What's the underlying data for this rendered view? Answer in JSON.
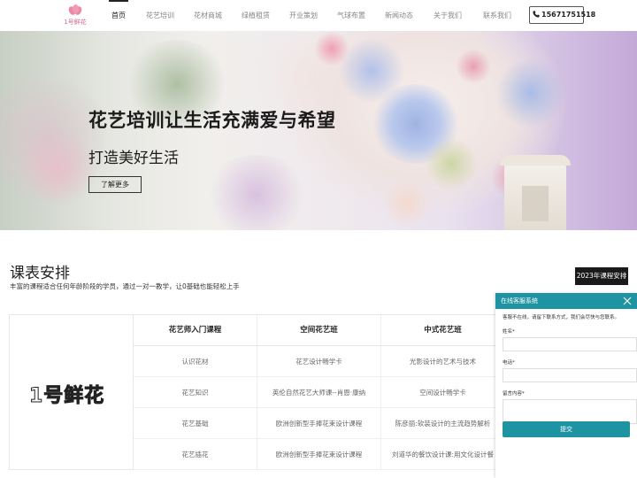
{
  "header": {
    "logo_text": "1号鲜花",
    "nav": [
      {
        "label": "首页",
        "active": true
      },
      {
        "label": "花艺培训",
        "active": false
      },
      {
        "label": "花材商城",
        "active": false
      },
      {
        "label": "绿植租赁",
        "active": false
      },
      {
        "label": "开业策划",
        "active": false
      },
      {
        "label": "气球布置",
        "active": false
      },
      {
        "label": "新闻动态",
        "active": false
      },
      {
        "label": "关于我们",
        "active": false
      },
      {
        "label": "联系我们",
        "active": false
      }
    ],
    "phone": "15671751518",
    "phone_icon": "phone-icon"
  },
  "banner": {
    "title": "花艺培训让生活充满爱与希望",
    "subtitle": "打造美好生活",
    "button": "了解更多"
  },
  "courses": {
    "title": "课表安排",
    "description": "丰富的课程适合任何年龄阶段的学员，通过一对一教学，让0基础也能轻松上手",
    "year_button": "2023年课程安排",
    "logo_text": "1号鲜花",
    "columns": [
      "花艺师入门课程",
      "空间花艺班",
      "中式花艺班"
    ],
    "rows": [
      [
        "认识花材",
        "花艺设计畅学卡",
        "光影设计的艺术与技术"
      ],
      [
        "花艺知识",
        "英伦自然花艺大师课--肖恩·康纳",
        "空间设计畅学卡"
      ],
      [
        "花艺基础",
        "欧洲创新型手捧花束设计课程",
        "陈彦丽:软装设计的主流趋势解析"
      ],
      [
        "花艺插花",
        "欧洲创新型手捧花束设计课程",
        "刘道华的餐饮设计课:用文化设计餐"
      ]
    ]
  },
  "chat": {
    "title": "在线客服系统",
    "close_icon": "close-icon",
    "note": "客服不在线，请留下联系方式，我们会尽快与您联系。",
    "name_label": "姓名*",
    "phone_label": "电话*",
    "message_label": "留言内容*",
    "submit": "提交"
  },
  "colors": {
    "accent": "#1e93a1",
    "nav_active": "#222222",
    "year_button_bg": "#1a1a1a"
  }
}
